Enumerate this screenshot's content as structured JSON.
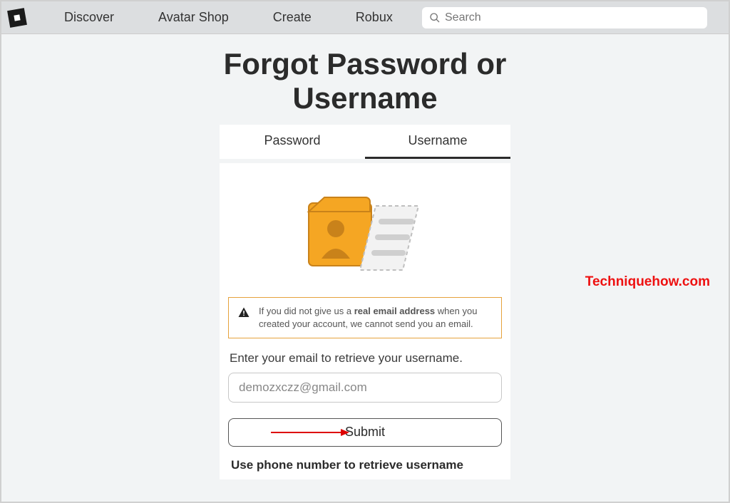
{
  "nav": {
    "items": [
      "Discover",
      "Avatar Shop",
      "Create",
      "Robux"
    ],
    "search_placeholder": "Search"
  },
  "title": "Forgot Password or Username",
  "tabs": {
    "password": "Password",
    "username": "Username"
  },
  "alert": {
    "pre": "If you did not give us a ",
    "bold": "real email address",
    "post": " when you created your account, we cannot send you an email."
  },
  "instruction": "Enter your email to retrieve your username.",
  "email_value": "demozxczz@gmail.com",
  "submit_label": "Submit",
  "phone_link": "Use phone number to retrieve username",
  "watermark": "Techniquehow.com"
}
